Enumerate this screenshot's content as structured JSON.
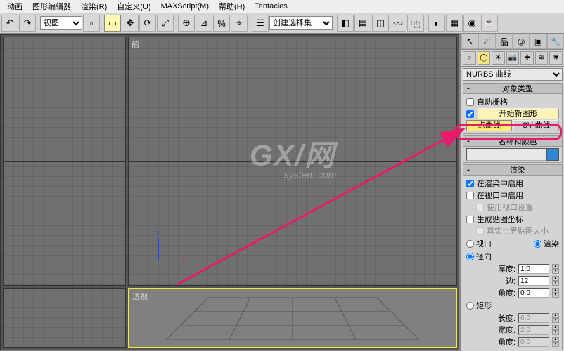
{
  "menu": {
    "anim": "动画",
    "gfxedit": "图形编辑器",
    "render": "渲染(R)",
    "custom": "自定义(U)",
    "maxscript": "MAXScript(M)",
    "help": "帮助(H)",
    "tentacles": "Tentacles"
  },
  "toolbar": {
    "view_sel": "视图",
    "selset": "创建选择集"
  },
  "viewports": {
    "front": "前",
    "persp": "透视"
  },
  "watermark": {
    "main": "GX/网",
    "sub": "system.com"
  },
  "panel": {
    "dropdown": "NURBS 曲线",
    "roll_objtype": "对象类型",
    "autogrid": "自动栅格",
    "startshape": "开始新图形",
    "point_curve": "点曲线",
    "cv_curve": "CV 曲线",
    "roll_namecolor": "名称和颜色",
    "roll_render": "渲染",
    "enable_render": "在渲染中启用",
    "enable_viewport": "在视口中启用",
    "use_vp_settings": "使用视口设置",
    "gen_map_coords": "生成贴图坐标",
    "realworld_map": "真实世界贴图大小",
    "radio_vp": "视口",
    "radio_render": "渲染",
    "radio_radial": "径向",
    "thickness": "厚度:",
    "thickness_val": "1.0",
    "sides": "边:",
    "sides_val": "12",
    "angle": "角度:",
    "angle_val": "0.0",
    "radio_rect": "矩形",
    "length": "长度:",
    "length_val": "6.0",
    "width": "宽度:",
    "width_val": "2.0",
    "angle2": "角度:",
    "angle2_val": "0.0"
  }
}
